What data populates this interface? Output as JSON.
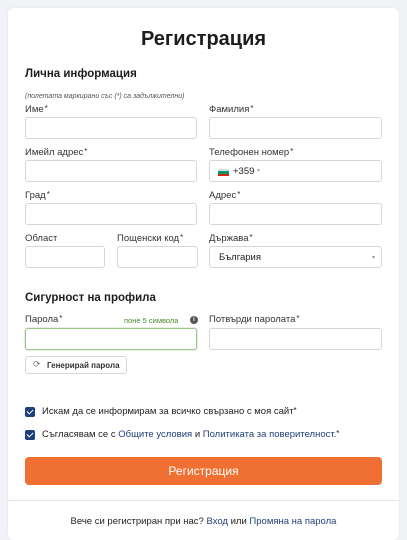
{
  "page": {
    "title": "Регистрация"
  },
  "personal": {
    "heading": "Лична информация",
    "note": "(полетата маркирани със (*) са задължителни)",
    "first_name": {
      "label": "Име",
      "value": ""
    },
    "last_name": {
      "label": "Фамилия",
      "value": ""
    },
    "email": {
      "label": "Имейл адрес",
      "value": ""
    },
    "phone": {
      "label": "Телефонен номер",
      "code": "+359",
      "value": ""
    },
    "city": {
      "label": "Град",
      "value": ""
    },
    "address": {
      "label": "Адрес",
      "value": ""
    },
    "region": {
      "label": "Област",
      "value": ""
    },
    "postal": {
      "label": "Пощенски код",
      "value": ""
    },
    "country": {
      "label": "Държава",
      "selected": "България"
    }
  },
  "security": {
    "heading": "Сигурност на профила",
    "password": {
      "label": "Парола",
      "hint": "поне 5 символа",
      "value": ""
    },
    "confirm": {
      "label": "Потвърди паролата",
      "value": ""
    },
    "generate_label": "Генерирай парола"
  },
  "consents": {
    "newsletter": {
      "text": "Искам да се информирам за всичко свързано с моя сайт",
      "checked": true
    },
    "terms": {
      "prefix": "Съгласявам се с ",
      "terms_link": "Общите условия",
      "and": " и ",
      "privacy_link": "Политиката за поверителност",
      "suffix": ".",
      "checked": true
    }
  },
  "submit_label": "Регистрация",
  "footer": {
    "text": "Вече си регистриран при нас? ",
    "login_link": "Вход",
    "or": " или ",
    "reset_link": "Промяна на парола"
  },
  "required_mark": "*",
  "colors": {
    "accent": "#f07033",
    "link": "#1f3f7a",
    "hint": "#4a8a2a"
  }
}
